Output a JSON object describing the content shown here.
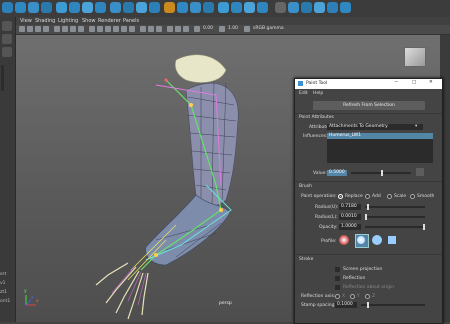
{
  "viewport_menu": {
    "view": "View",
    "shading": "Shading",
    "lighting": "Lighting",
    "show": "Show",
    "renderer": "Renderer",
    "panels": "Panels"
  },
  "toolbar": {
    "value1": "0.00",
    "value2": "1.00",
    "color_space": "sRGB gamma",
    "camera_label": "persp"
  },
  "axis_labels": {
    "x": "x",
    "y": "y",
    "z": "z"
  },
  "left_labels": [
    "ert",
    "v1",
    "zt1",
    "ont1"
  ],
  "paint_tool": {
    "title": "Paint Tool",
    "menu": {
      "edit": "Edit",
      "help": "Help"
    },
    "refresh_button": "Refresh From Selection",
    "point_attributes_header": "Point Attributes",
    "attribute_label": "Attribute:",
    "attribute_value": "Attachments To Geometry",
    "influences_label": "Influences:",
    "influence_selected": "Humerus_LW1",
    "value_label": "Value:",
    "value": "0.5000",
    "brush_header": "Brush",
    "paint_operation_label": "Paint operation:",
    "operations": [
      "Replace",
      "Add",
      "Scale",
      "Smooth"
    ],
    "selected_operation": "Replace",
    "radius_u_label": "Radius(U):",
    "radius_u": "0.7180",
    "radius_l_label": "Radius(L):",
    "radius_l": "0.0010",
    "opacity_label": "Opacity:",
    "opacity": "1.0000",
    "profile_label": "Profile:",
    "stroke_header": "Stroke",
    "screen_projection": "Screen projection",
    "reflection": "Reflection",
    "reflection_about_origin": "Reflection about origin",
    "reflection_axis_label": "Reflection axis:",
    "axes": [
      "X",
      "Y",
      "Z"
    ],
    "stamp_spacing_label": "Stamp spacing:",
    "stamp_spacing": "0.1000"
  },
  "colors": {
    "accent": "#5285a6",
    "title_bg": "#ffffff",
    "panel_bg": "#444444",
    "viewport_top": "#6f6f6f"
  }
}
